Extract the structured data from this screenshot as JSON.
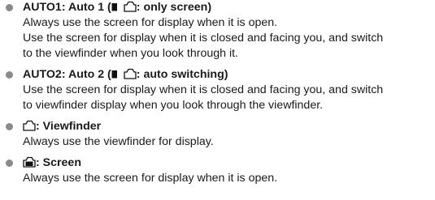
{
  "items": [
    {
      "name": "AUTO1",
      "label": "Auto 1",
      "mode": "only screen",
      "lines": [
        "Always use the screen for display when it is open.",
        "Use the screen for display when it is closed and facing you, and switch",
        "to the viewfinder when you look through it."
      ]
    },
    {
      "name": "AUTO2",
      "label": "Auto 2",
      "mode": "auto switching",
      "lines": [
        "Use the screen for display when it is closed and facing you, and switch",
        "to viewfinder display when you look through the viewfinder."
      ]
    },
    {
      "label": "Viewfinder",
      "icon": "viewfinder-icon",
      "lines": [
        "Always use the viewfinder for display."
      ]
    },
    {
      "label": "Screen",
      "icon": "screen-icon",
      "lines": [
        "Always use the screen for display when it is open."
      ]
    }
  ],
  "punct": {
    "colon": ": ",
    "open_paren": " (",
    "colon_short": ": ",
    "close_paren": ")"
  }
}
